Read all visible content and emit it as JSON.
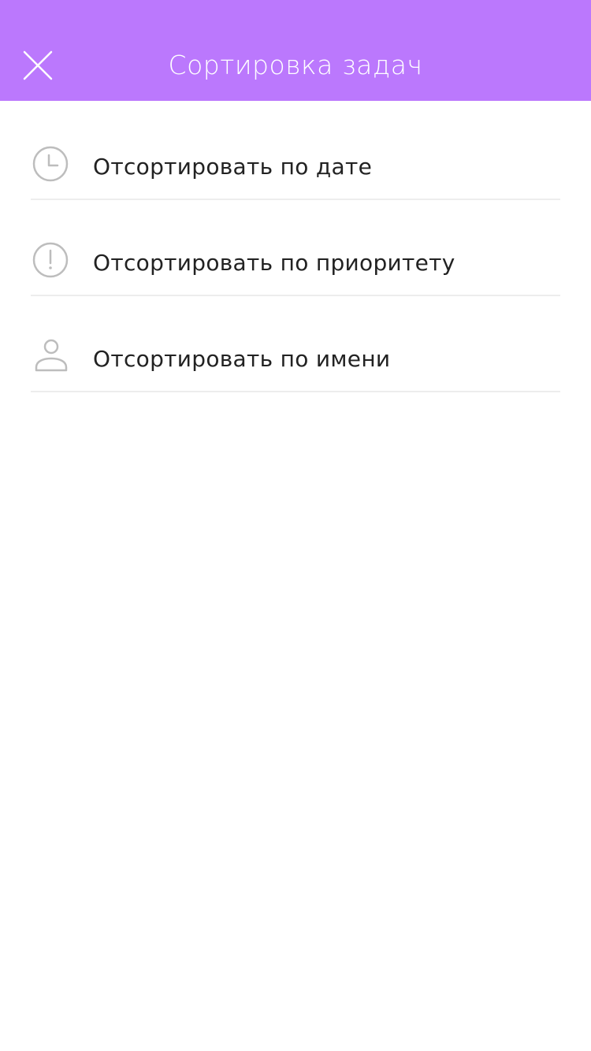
{
  "header": {
    "title": "Сортировка задач",
    "background_color": "#bb78fd",
    "close_icon": "close-icon"
  },
  "sort_options": [
    {
      "label": "Отсортировать по дате",
      "icon": "clock-icon"
    },
    {
      "label": "Отсортировать по приоритету",
      "icon": "exclamation-circle-icon"
    },
    {
      "label": "Отсортировать по имени",
      "icon": "person-icon"
    }
  ],
  "colors": {
    "icon_gray": "#bdbdbd",
    "divider": "#ededed",
    "text": "#222222"
  }
}
